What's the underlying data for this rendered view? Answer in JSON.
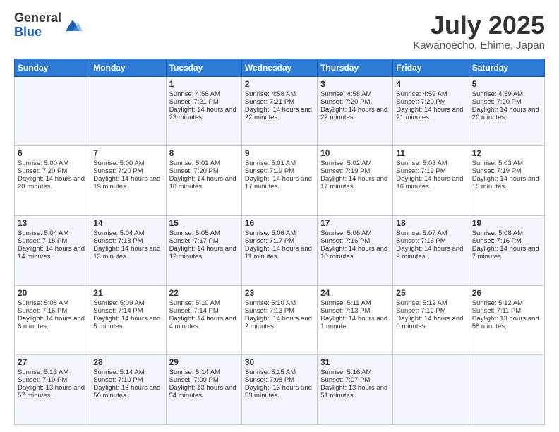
{
  "logo": {
    "general": "General",
    "blue": "Blue"
  },
  "header": {
    "month": "July 2025",
    "location": "Kawanoecho, Ehime, Japan"
  },
  "weekdays": [
    "Sunday",
    "Monday",
    "Tuesday",
    "Wednesday",
    "Thursday",
    "Friday",
    "Saturday"
  ],
  "weeks": [
    [
      {
        "day": "",
        "sunrise": "",
        "sunset": "",
        "daylight": ""
      },
      {
        "day": "",
        "sunrise": "",
        "sunset": "",
        "daylight": ""
      },
      {
        "day": "1",
        "sunrise": "Sunrise: 4:58 AM",
        "sunset": "Sunset: 7:21 PM",
        "daylight": "Daylight: 14 hours and 23 minutes."
      },
      {
        "day": "2",
        "sunrise": "Sunrise: 4:58 AM",
        "sunset": "Sunset: 7:21 PM",
        "daylight": "Daylight: 14 hours and 22 minutes."
      },
      {
        "day": "3",
        "sunrise": "Sunrise: 4:58 AM",
        "sunset": "Sunset: 7:20 PM",
        "daylight": "Daylight: 14 hours and 22 minutes."
      },
      {
        "day": "4",
        "sunrise": "Sunrise: 4:59 AM",
        "sunset": "Sunset: 7:20 PM",
        "daylight": "Daylight: 14 hours and 21 minutes."
      },
      {
        "day": "5",
        "sunrise": "Sunrise: 4:59 AM",
        "sunset": "Sunset: 7:20 PM",
        "daylight": "Daylight: 14 hours and 20 minutes."
      }
    ],
    [
      {
        "day": "6",
        "sunrise": "Sunrise: 5:00 AM",
        "sunset": "Sunset: 7:20 PM",
        "daylight": "Daylight: 14 hours and 20 minutes."
      },
      {
        "day": "7",
        "sunrise": "Sunrise: 5:00 AM",
        "sunset": "Sunset: 7:20 PM",
        "daylight": "Daylight: 14 hours and 19 minutes."
      },
      {
        "day": "8",
        "sunrise": "Sunrise: 5:01 AM",
        "sunset": "Sunset: 7:20 PM",
        "daylight": "Daylight: 14 hours and 18 minutes."
      },
      {
        "day": "9",
        "sunrise": "Sunrise: 5:01 AM",
        "sunset": "Sunset: 7:19 PM",
        "daylight": "Daylight: 14 hours and 17 minutes."
      },
      {
        "day": "10",
        "sunrise": "Sunrise: 5:02 AM",
        "sunset": "Sunset: 7:19 PM",
        "daylight": "Daylight: 14 hours and 17 minutes."
      },
      {
        "day": "11",
        "sunrise": "Sunrise: 5:03 AM",
        "sunset": "Sunset: 7:19 PM",
        "daylight": "Daylight: 14 hours and 16 minutes."
      },
      {
        "day": "12",
        "sunrise": "Sunrise: 5:03 AM",
        "sunset": "Sunset: 7:19 PM",
        "daylight": "Daylight: 14 hours and 15 minutes."
      }
    ],
    [
      {
        "day": "13",
        "sunrise": "Sunrise: 5:04 AM",
        "sunset": "Sunset: 7:18 PM",
        "daylight": "Daylight: 14 hours and 14 minutes."
      },
      {
        "day": "14",
        "sunrise": "Sunrise: 5:04 AM",
        "sunset": "Sunset: 7:18 PM",
        "daylight": "Daylight: 14 hours and 13 minutes."
      },
      {
        "day": "15",
        "sunrise": "Sunrise: 5:05 AM",
        "sunset": "Sunset: 7:17 PM",
        "daylight": "Daylight: 14 hours and 12 minutes."
      },
      {
        "day": "16",
        "sunrise": "Sunrise: 5:06 AM",
        "sunset": "Sunset: 7:17 PM",
        "daylight": "Daylight: 14 hours and 11 minutes."
      },
      {
        "day": "17",
        "sunrise": "Sunrise: 5:06 AM",
        "sunset": "Sunset: 7:16 PM",
        "daylight": "Daylight: 14 hours and 10 minutes."
      },
      {
        "day": "18",
        "sunrise": "Sunrise: 5:07 AM",
        "sunset": "Sunset: 7:16 PM",
        "daylight": "Daylight: 14 hours and 9 minutes."
      },
      {
        "day": "19",
        "sunrise": "Sunrise: 5:08 AM",
        "sunset": "Sunset: 7:16 PM",
        "daylight": "Daylight: 14 hours and 7 minutes."
      }
    ],
    [
      {
        "day": "20",
        "sunrise": "Sunrise: 5:08 AM",
        "sunset": "Sunset: 7:15 PM",
        "daylight": "Daylight: 14 hours and 6 minutes."
      },
      {
        "day": "21",
        "sunrise": "Sunrise: 5:09 AM",
        "sunset": "Sunset: 7:14 PM",
        "daylight": "Daylight: 14 hours and 5 minutes."
      },
      {
        "day": "22",
        "sunrise": "Sunrise: 5:10 AM",
        "sunset": "Sunset: 7:14 PM",
        "daylight": "Daylight: 14 hours and 4 minutes."
      },
      {
        "day": "23",
        "sunrise": "Sunrise: 5:10 AM",
        "sunset": "Sunset: 7:13 PM",
        "daylight": "Daylight: 14 hours and 2 minutes."
      },
      {
        "day": "24",
        "sunrise": "Sunrise: 5:11 AM",
        "sunset": "Sunset: 7:13 PM",
        "daylight": "Daylight: 14 hours and 1 minute."
      },
      {
        "day": "25",
        "sunrise": "Sunrise: 5:12 AM",
        "sunset": "Sunset: 7:12 PM",
        "daylight": "Daylight: 14 hours and 0 minutes."
      },
      {
        "day": "26",
        "sunrise": "Sunrise: 5:12 AM",
        "sunset": "Sunset: 7:11 PM",
        "daylight": "Daylight: 13 hours and 58 minutes."
      }
    ],
    [
      {
        "day": "27",
        "sunrise": "Sunrise: 5:13 AM",
        "sunset": "Sunset: 7:10 PM",
        "daylight": "Daylight: 13 hours and 57 minutes."
      },
      {
        "day": "28",
        "sunrise": "Sunrise: 5:14 AM",
        "sunset": "Sunset: 7:10 PM",
        "daylight": "Daylight: 13 hours and 56 minutes."
      },
      {
        "day": "29",
        "sunrise": "Sunrise: 5:14 AM",
        "sunset": "Sunset: 7:09 PM",
        "daylight": "Daylight: 13 hours and 54 minutes."
      },
      {
        "day": "30",
        "sunrise": "Sunrise: 5:15 AM",
        "sunset": "Sunset: 7:08 PM",
        "daylight": "Daylight: 13 hours and 53 minutes."
      },
      {
        "day": "31",
        "sunrise": "Sunrise: 5:16 AM",
        "sunset": "Sunset: 7:07 PM",
        "daylight": "Daylight: 13 hours and 51 minutes."
      },
      {
        "day": "",
        "sunrise": "",
        "sunset": "",
        "daylight": ""
      },
      {
        "day": "",
        "sunrise": "",
        "sunset": "",
        "daylight": ""
      }
    ]
  ]
}
